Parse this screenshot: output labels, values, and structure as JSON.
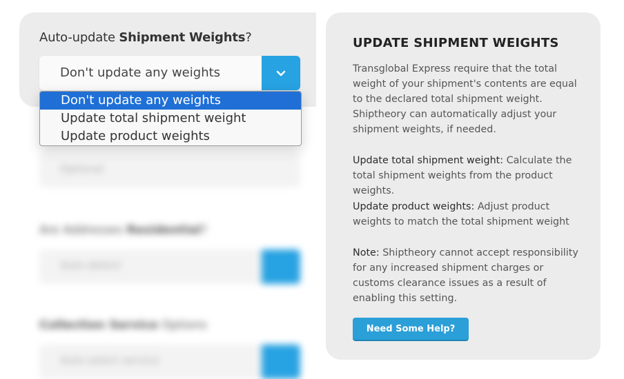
{
  "field": {
    "label_prefix": "Auto-update ",
    "label_bold": "Shipment Weights",
    "label_suffix": "?",
    "selected_value": "Don't update any weights",
    "options": [
      "Don't update any weights",
      "Update total shipment weight",
      "Update product weights"
    ]
  },
  "background_form": {
    "field2_hint": "Optional",
    "field3_label_prefix": "Are Addresses ",
    "field3_label_bold": "Residential",
    "field3_label_suffix": "?",
    "field3_value": "Auto-detect",
    "field4_label_bold": "Collection Service",
    "field4_label_suffix": " Options",
    "field4_value": "Auto-select service"
  },
  "help": {
    "title": "UPDATE SHIPMENT WEIGHTS",
    "intro": "Transglobal Express require that the total weight of your shipment's contents are equal to the declared total shipment weight. Shiptheory can automatically adjust your shipment weights, if needed.",
    "total_label": "Update total shipment weight:",
    "total_text": " Calculate the total shipment weights from the product weights.",
    "product_label": "Update product weights:",
    "product_text": " Adjust product weights to match the total shipment weight",
    "note_label": "Note:",
    "note_text": " Shiptheory cannot accept responsibility for any increased shipment charges or customs clearance issues as a result of enabling this setting.",
    "button_label": "Need Some Help?"
  },
  "colors": {
    "accent": "#27a2e2",
    "selected_option": "#1f6fd6",
    "panel_bg": "#ececec"
  }
}
